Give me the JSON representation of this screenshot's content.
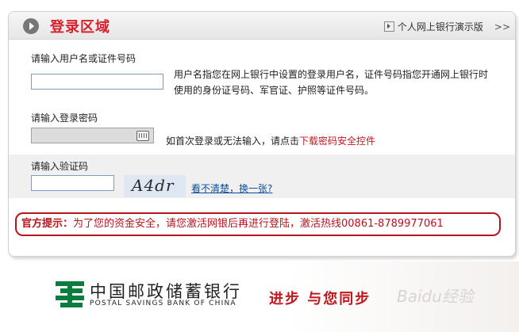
{
  "header": {
    "title": "登录区域",
    "demo_link": "个人网上银行演示版",
    "demo_arrows": ">>"
  },
  "username": {
    "label": "请输入用户名或证件号码",
    "value": "",
    "hint_line1": "用户名指您在网上银行中设置的登录用户名，证件号码指您开通网上银行时",
    "hint_line2": "使用的身份证号码、军官证、护照等证件号码。"
  },
  "password": {
    "label": "请输入登录密码",
    "hint_prefix": "如首次登录或无法输入，请点击",
    "download_link": "下载密码安全控件"
  },
  "captcha": {
    "label": "请输入验证码",
    "value": "",
    "image_text": "A4dr",
    "refresh_link": "看不清楚，换一张?"
  },
  "notice": {
    "prefix": "官方提示：",
    "text": "为了您的资金安全，请您激活网银后再进行登陆，激活热线00861-8789977061"
  },
  "footer": {
    "bank_name_cn": "中国邮政储蓄银行",
    "bank_name_en": "POSTAL SAVINGS BANK OF CHINA",
    "slogan": "进步 与您同步",
    "watermark": "Baidu经验"
  },
  "colors": {
    "brand_red": "#d6212b",
    "brand_green": "#0a7d3e",
    "link_blue": "#0a4f9c"
  }
}
